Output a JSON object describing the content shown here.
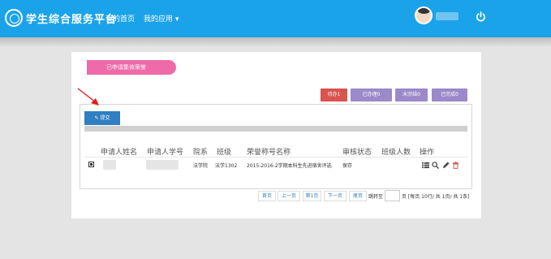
{
  "header": {
    "app_title": "学生综合服务平台",
    "nav": {
      "home": "我的首页",
      "apps": "我的应用 ▾"
    }
  },
  "colors": {
    "topbar": "#1ba3ea",
    "ribbon": "#ee6aa8",
    "pending": "#d9534f",
    "status": "#9b8ac9",
    "submit": "#2f7fc1"
  },
  "page": {
    "ribbon_title": "已申请集体荣誉",
    "stats": [
      "待办1",
      "已办理0",
      "未完结0",
      "已完成0"
    ],
    "submit_label": "提交"
  },
  "table": {
    "columns": [
      "申请人姓名",
      "申请人学号",
      "院系",
      "班级",
      "荣誉称号名称",
      "审核状态",
      "班级人数",
      "操作"
    ],
    "rows": [
      {
        "college": "法学院",
        "class": "法学1302",
        "honor": "2015-2016-2学期本科生先进宿舍评选",
        "status": "保存",
        "count": ""
      }
    ]
  },
  "pagination": {
    "first": "首页",
    "prev": "上一页",
    "current": "第1页",
    "next": "下一页",
    "last": "尾页",
    "jump_label": "跳转至",
    "summary": "页 [每页 10行/ 共 1页/ 共 1条]"
  },
  "icons": [
    "logo-icon",
    "power-icon",
    "edit-icon",
    "checkbox-icon",
    "list-icon",
    "search-icon",
    "pencil-icon",
    "trash-icon",
    "arrow-annotation"
  ]
}
